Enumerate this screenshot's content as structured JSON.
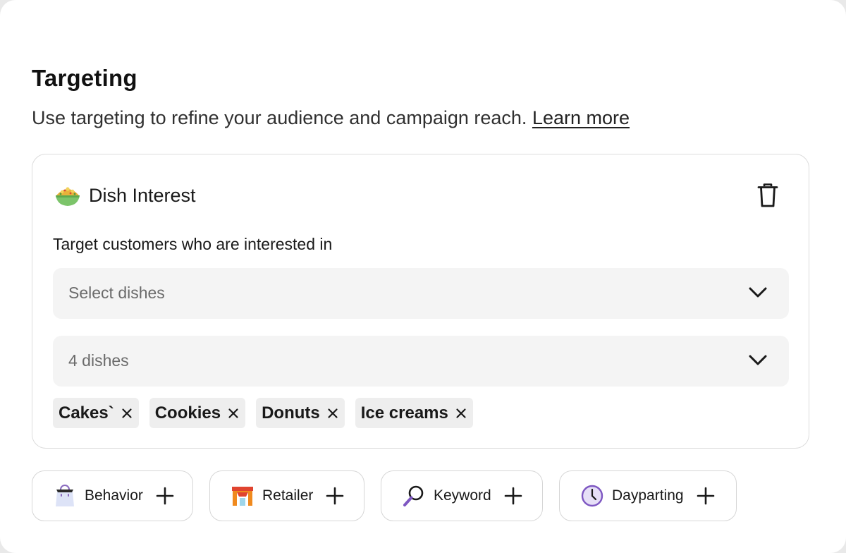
{
  "header": {
    "title": "Targeting",
    "subtitle": "Use targeting to refine your audience and campaign reach.",
    "learn_more": "Learn more"
  },
  "dish_card": {
    "title": "Dish Interest",
    "icon": "salad-bowl-icon",
    "prompt": "Target customers who are interested in",
    "select_placeholder": "Select dishes",
    "selected_summary": "4 dishes",
    "chips": [
      {
        "label": "Cakes`"
      },
      {
        "label": "Cookies"
      },
      {
        "label": "Donuts"
      },
      {
        "label": "Ice creams"
      }
    ]
  },
  "add_options": [
    {
      "label": "Behavior",
      "icon": "shopping-bag-icon"
    },
    {
      "label": "Retailer",
      "icon": "storefront-icon"
    },
    {
      "label": "Keyword",
      "icon": "magnifier-icon"
    },
    {
      "label": "Dayparting",
      "icon": "clock-icon"
    }
  ],
  "colors": {
    "background": "#ffffff",
    "field_background": "#f4f4f4",
    "chip_background": "#eeeeee",
    "border": "#dcdcdc",
    "text": "#191919",
    "muted_text": "#6b6b6b"
  }
}
